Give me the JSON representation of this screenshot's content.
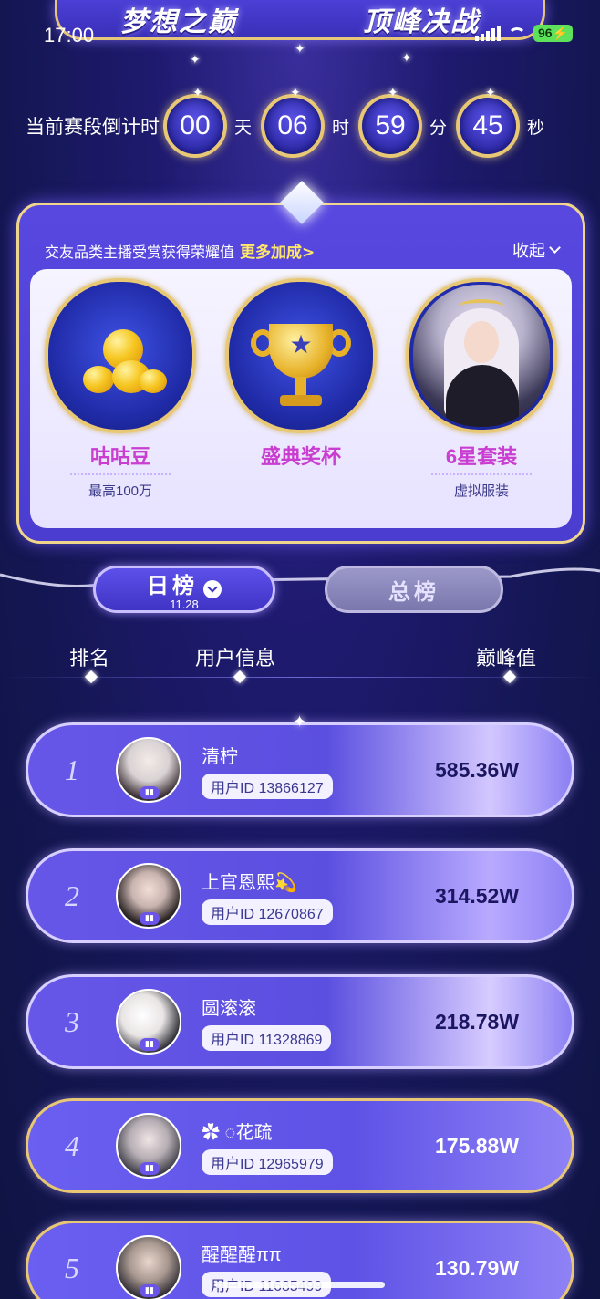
{
  "status_bar": {
    "time": "17:00",
    "battery": "96"
  },
  "banner": {
    "title_left": "梦想之巅",
    "title_right": "顶峰决战"
  },
  "countdown": {
    "label": "当前赛段倒计时",
    "units": [
      {
        "value": "00",
        "suffix": "天"
      },
      {
        "value": "06",
        "suffix": "时"
      },
      {
        "value": "59",
        "suffix": "分"
      },
      {
        "value": "45",
        "suffix": "秒"
      }
    ]
  },
  "reward_panel": {
    "description": "交友品类主播受赏获得荣耀值",
    "more_link": "更多加成>",
    "collapse_label": "收起",
    "items": [
      {
        "name": "咕咕豆",
        "sub": "最高100万",
        "icon": "beans-icon"
      },
      {
        "name": "盛典奖杯",
        "sub": "",
        "icon": "trophy-icon"
      },
      {
        "name": "6星套装",
        "sub": "虚拟服装",
        "icon": "costume-icon"
      }
    ]
  },
  "tabs": {
    "day": {
      "label": "日榜",
      "date": "11.28"
    },
    "total": {
      "label": "总榜"
    }
  },
  "columns": {
    "rank": "排名",
    "user": "用户信息",
    "score": "巅峰值"
  },
  "rankings": [
    {
      "rank": "1",
      "name": "清柠",
      "id": "用户ID 13866127",
      "score": "585.36W"
    },
    {
      "rank": "2",
      "name": "上官恩熙💫",
      "id": "用户ID 12670867",
      "score": "314.52W"
    },
    {
      "rank": "3",
      "name": "圆滚滚",
      "id": "用户ID 11328869",
      "score": "218.78W"
    },
    {
      "rank": "4",
      "name": "✿ ◌花疏",
      "id": "用户ID 12965979",
      "score": "175.88W"
    },
    {
      "rank": "5",
      "name": "醒醒醒ππ",
      "id": "用户ID 11685499",
      "score": "130.79W"
    }
  ],
  "colors": {
    "gold": "#e8c874",
    "row_gradient_start": "#6a5ff0",
    "row_gradient_end": "#c7b8ff"
  }
}
